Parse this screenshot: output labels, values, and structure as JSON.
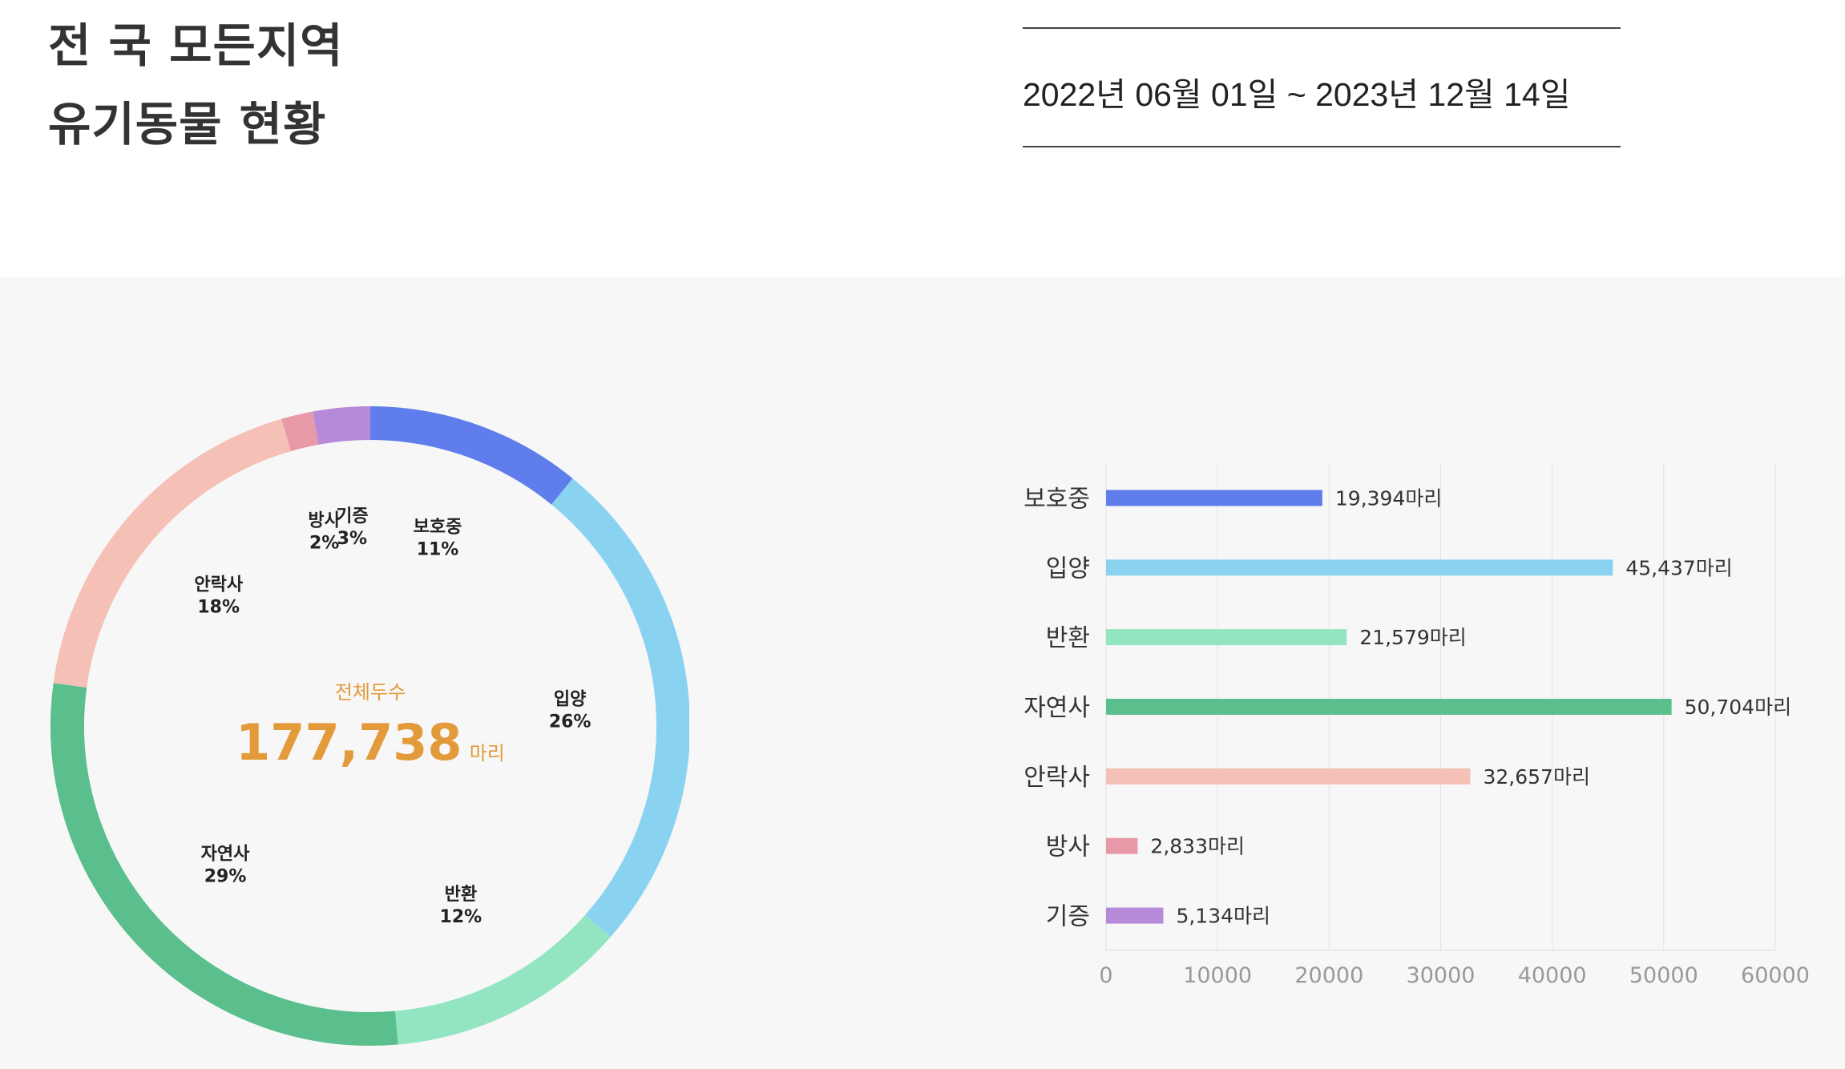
{
  "header": {
    "title_line1": "전 국 모든지역",
    "title_line2": "유기동물 현황",
    "date_range": "2022년 06월 01일 ~ 2023년 12월 14일"
  },
  "summary": {
    "total_label": "전체두수",
    "total_value": "177,738",
    "total_unit": "마리"
  },
  "chart_data": [
    {
      "type": "pie",
      "categories": [
        "보호중",
        "입양",
        "반환",
        "자연사",
        "안락사",
        "방사",
        "기증"
      ],
      "values": [
        19394,
        45437,
        21579,
        50704,
        32657,
        2833,
        5134
      ],
      "percent_labels": [
        "11%",
        "26%",
        "12%",
        "29%",
        "18%",
        "2%",
        "3%"
      ],
      "colors": [
        "#5f7deb",
        "#8ad3f0",
        "#93e5c1",
        "#5bbf8d",
        "#f5c0b5",
        "#e899a8",
        "#b68ad8"
      ],
      "donut": true
    },
    {
      "type": "bar",
      "orientation": "horizontal",
      "categories": [
        "보호중",
        "입양",
        "반환",
        "자연사",
        "안락사",
        "방사",
        "기증"
      ],
      "values": [
        19394,
        45437,
        21579,
        50704,
        32657,
        2833,
        5134
      ],
      "value_labels": [
        "19,394마리",
        "45,437마리",
        "21,579마리",
        "50,704마리",
        "32,657마리",
        "2,833마리",
        "5,134마리"
      ],
      "colors": [
        "#5f7deb",
        "#8ad3f0",
        "#93e5c1",
        "#5bbf8d",
        "#f5c0b5",
        "#e899a8",
        "#b68ad8"
      ],
      "xlim": [
        0,
        60000
      ],
      "xticks": [
        "0",
        "10000",
        "20000",
        "30000",
        "40000",
        "50000",
        "60000"
      ],
      "grid": true
    }
  ]
}
